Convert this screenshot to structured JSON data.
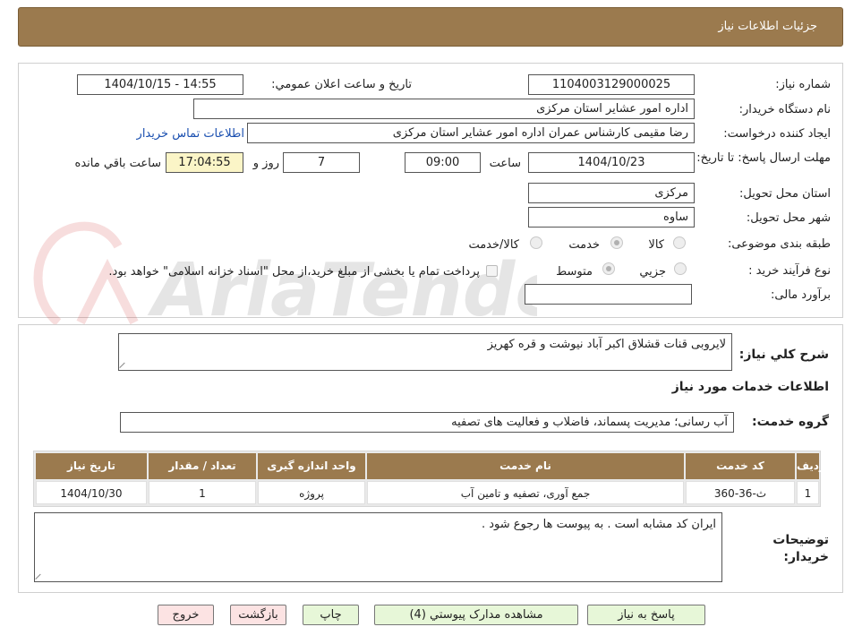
{
  "header": {
    "title": "جزئیات اطلاعات نیاز"
  },
  "watermark": {
    "brand": "AriaTender.net"
  },
  "form": {
    "need_number_label": "شماره نیاز:",
    "need_number": "1104003129000025",
    "announce_label": "تاریخ و ساعت اعلان عمومي:",
    "announce_value": "1404/10/15 - 14:55",
    "buyer_label": "نام دستگاه خريدار:",
    "buyer_value": "اداره امور عشایر استان مرکزی",
    "requester_label": "ايجاد كننده درخواست:",
    "requester_value": "رضا مقیمی کارشناس عمران اداره امور عشایر استان مرکزی",
    "contact_link": "اطلاعات تماس خريدار",
    "deadline_label": "مهلت ارسال پاسخ: تا تاریخ:",
    "deadline_date": "1404/10/23",
    "time_label": "ساعت",
    "deadline_time": "09:00",
    "days_value": "7",
    "days_label": "روز و",
    "remaining_time": "17:04:55",
    "remaining_label": "ساعت باقي مانده",
    "province_label": "استان محل تحويل:",
    "province_value": "مرکزی",
    "city_label": "شهر محل تحويل:",
    "city_value": "ساوه",
    "category_label": "طبقه بندی موضوعی:",
    "category_options": [
      "كالا",
      "خدمت",
      "كالا/خدمت"
    ],
    "process_label": "نوع فرآيند خريد :",
    "process_options": [
      "جزيي",
      "متوسط"
    ],
    "payment_note": "پرداخت تمام يا بخشی از مبلغ خريد،از محل \"اسناد خزانه اسلامی\" خواهد بود.",
    "estimate_label": "برآورد مالی:",
    "estimate_value": ""
  },
  "summary": {
    "label": "شرح کلي نياز:",
    "value": "لایروبی قنات قشلاق اکبر آباد نیوشت و قره کهریز"
  },
  "services": {
    "section_title": "اطلاعات خدمات مورد نياز",
    "group_label": "گروه خدمت:",
    "group_value": "آب رسانی؛ مدیریت پسماند، فاضلاب و فعالیت های تصفیه",
    "table": {
      "headers": [
        "رديف",
        "کد خدمت",
        "نام خدمت",
        "واحد اندازه گيری",
        "تعداد / مقدار",
        "تاريخ نياز"
      ],
      "rows": [
        [
          "1",
          "ث-36-360",
          "جمع آوری، تصفیه و تامین آب",
          "پروژه",
          "1",
          "1404/10/30"
        ]
      ]
    }
  },
  "notes": {
    "label": "توضيحات خريدار:",
    "value": "ایران کد مشابه است . به پیوست ها رجوع شود ."
  },
  "buttons": {
    "reply": "پاسخ به نياز",
    "attachments": "مشاهده مدارک پيوستي (4)",
    "print": "چاپ",
    "back": "بازگشت",
    "exit": "خروج"
  },
  "colors": {
    "header_bg": "#9b7a4e",
    "link": "#1a4fb0",
    "timer_bg": "#fbf5c7",
    "button_green": "#e7f7d8",
    "button_pink": "#fce3e3"
  }
}
